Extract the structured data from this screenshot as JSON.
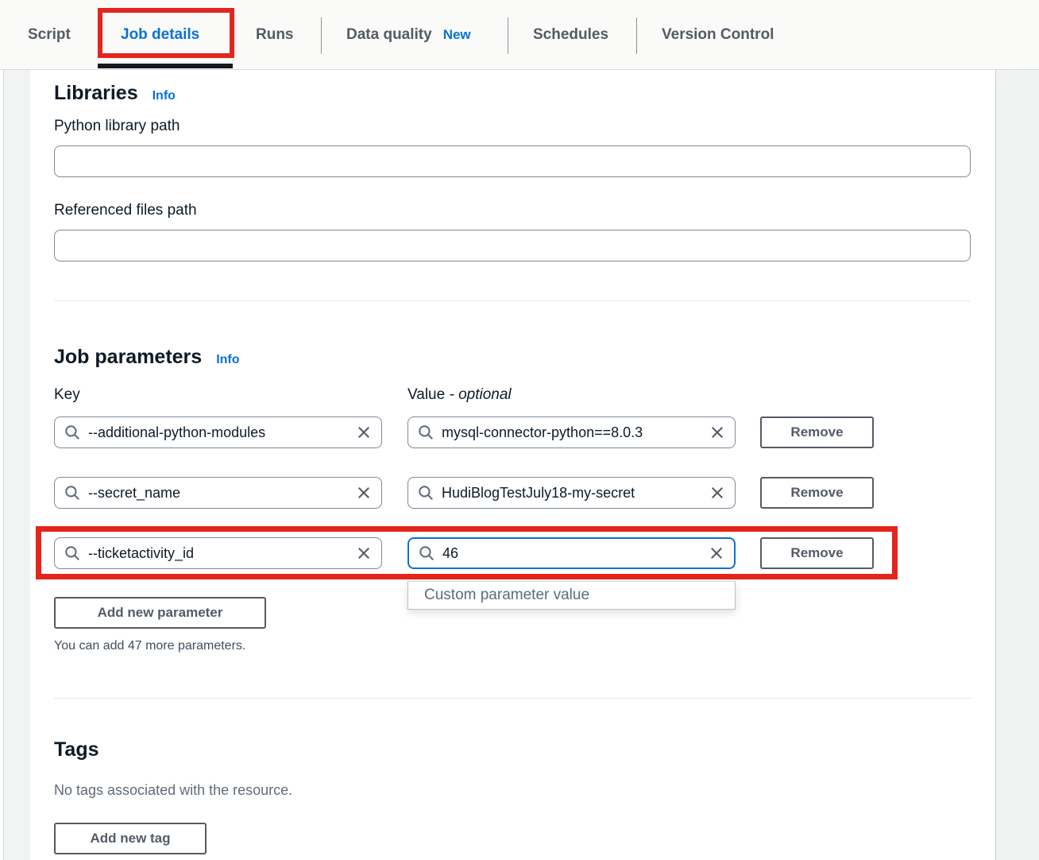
{
  "tabs": {
    "items": [
      {
        "label": "Script",
        "active": false
      },
      {
        "label": "Job details",
        "active": true,
        "annotated": true
      },
      {
        "label": "Runs",
        "active": false
      },
      {
        "label": "Data quality",
        "badge": "New",
        "active": false
      },
      {
        "label": "Schedules",
        "active": false
      },
      {
        "label": "Version Control",
        "active": false
      }
    ]
  },
  "libraries": {
    "heading": "Libraries",
    "info_label": "Info",
    "fields": [
      {
        "label": "Python library path",
        "value": ""
      },
      {
        "label": "Referenced files path",
        "value": ""
      }
    ]
  },
  "job_parameters": {
    "heading": "Job parameters",
    "info_label": "Info",
    "key_header": "Key",
    "value_header": "Value",
    "value_optional_suffix": "- optional",
    "remove_label": "Remove",
    "rows": [
      {
        "key": "--additional-python-modules",
        "value": "mysql-connector-python==8.0.3",
        "highlighted": false,
        "value_focused": false
      },
      {
        "key": "--secret_name",
        "value": "HudiBlogTestJuly18-my-secret",
        "highlighted": false,
        "value_focused": false
      },
      {
        "key": "--ticketactivity_id",
        "value": "46",
        "highlighted": true,
        "value_focused": true
      }
    ],
    "dropdown_hint": "Custom parameter value",
    "add_button_label": "Add new parameter",
    "remaining_note": "You can add 47 more parameters."
  },
  "tags": {
    "heading": "Tags",
    "empty_text": "No tags associated with the resource.",
    "add_button_label": "Add new tag"
  },
  "icons": {
    "search_icon": "magnifying-glass",
    "clear_icon": "x-cross"
  },
  "colors": {
    "accent_blue": "#0972d3",
    "annotation_red": "#e3251b",
    "tab_inactive": "#545b64",
    "active_tab_underline": "#15191e",
    "input_border": "#7d8998",
    "secondary_text": "#5f6b7a"
  }
}
